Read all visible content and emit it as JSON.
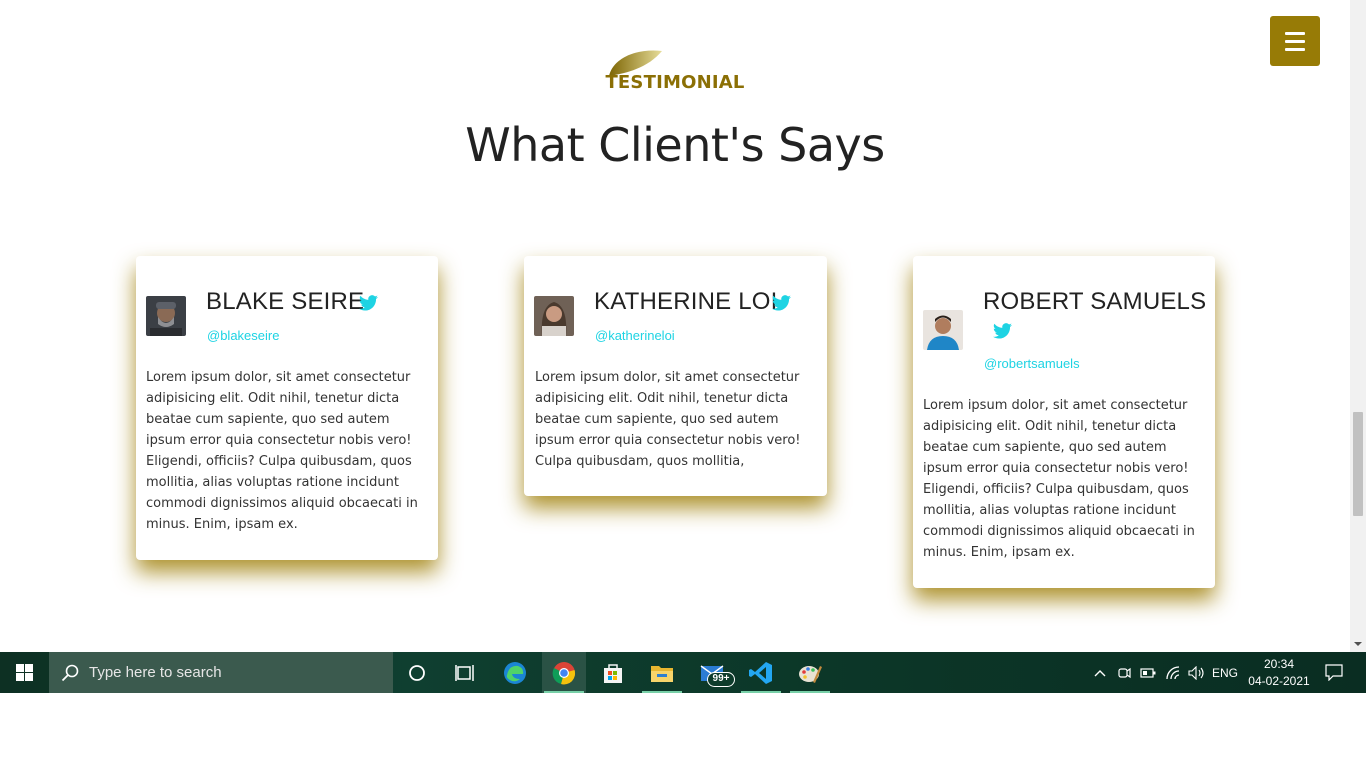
{
  "header": {
    "eyebrow": "TESTIMONIAL",
    "title": "What Client's Says",
    "menu_icon": "hamburger-icon",
    "accent_color": "#977b06"
  },
  "testimonials": [
    {
      "name": "BLAKE SEIRE",
      "handle": "@blakeseire",
      "text": "Lorem ipsum dolor, sit amet consectetur adipisicing elit. Odit nihil, tenetur dicta beatae cum sapiente, quo sed autem ipsum error quia consectetur nobis vero! Eligendi, officiis? Culpa quibusdam, quos mollitia, alias voluptas ratione incidunt commodi dignissimos aliquid obcaecati in minus. Enim, ipsam ex.",
      "icon": "twitter-icon"
    },
    {
      "name": "KATHERINE LOI",
      "handle": "@katherineloi",
      "text": "Lorem ipsum dolor, sit amet consectetur adipisicing elit. Odit nihil, tenetur dicta beatae cum sapiente, quo sed autem ipsum error quia consectetur nobis vero! Culpa quibusdam, quos mollitia,",
      "icon": "twitter-icon"
    },
    {
      "name": "ROBERT SAMUELS",
      "handle": "@robertsamuels",
      "text": "Lorem ipsum dolor, sit amet consectetur adipisicing elit. Odit nihil, tenetur dicta beatae cum sapiente, quo sed autem ipsum error quia consectetur nobis vero! Eligendi, officiis? Culpa quibusdam, quos mollitia, alias voluptas ratione incidunt commodi dignissimos aliquid obcaecati in minus. Enim, ipsam ex.",
      "icon": "twitter-icon"
    }
  ],
  "colors": {
    "handle": "#1ed3e3",
    "card_shadow": "#a0800a"
  },
  "taskbar": {
    "search_placeholder": "Type here to search",
    "mail_badge": "99+",
    "language": "ENG",
    "time": "20:34",
    "date": "04-02-2021",
    "apps": [
      "cortana-icon",
      "task-view-icon",
      "edge-icon",
      "chrome-icon",
      "store-icon",
      "file-explorer-icon",
      "mail-icon",
      "vscode-icon",
      "paint-icon"
    ]
  }
}
